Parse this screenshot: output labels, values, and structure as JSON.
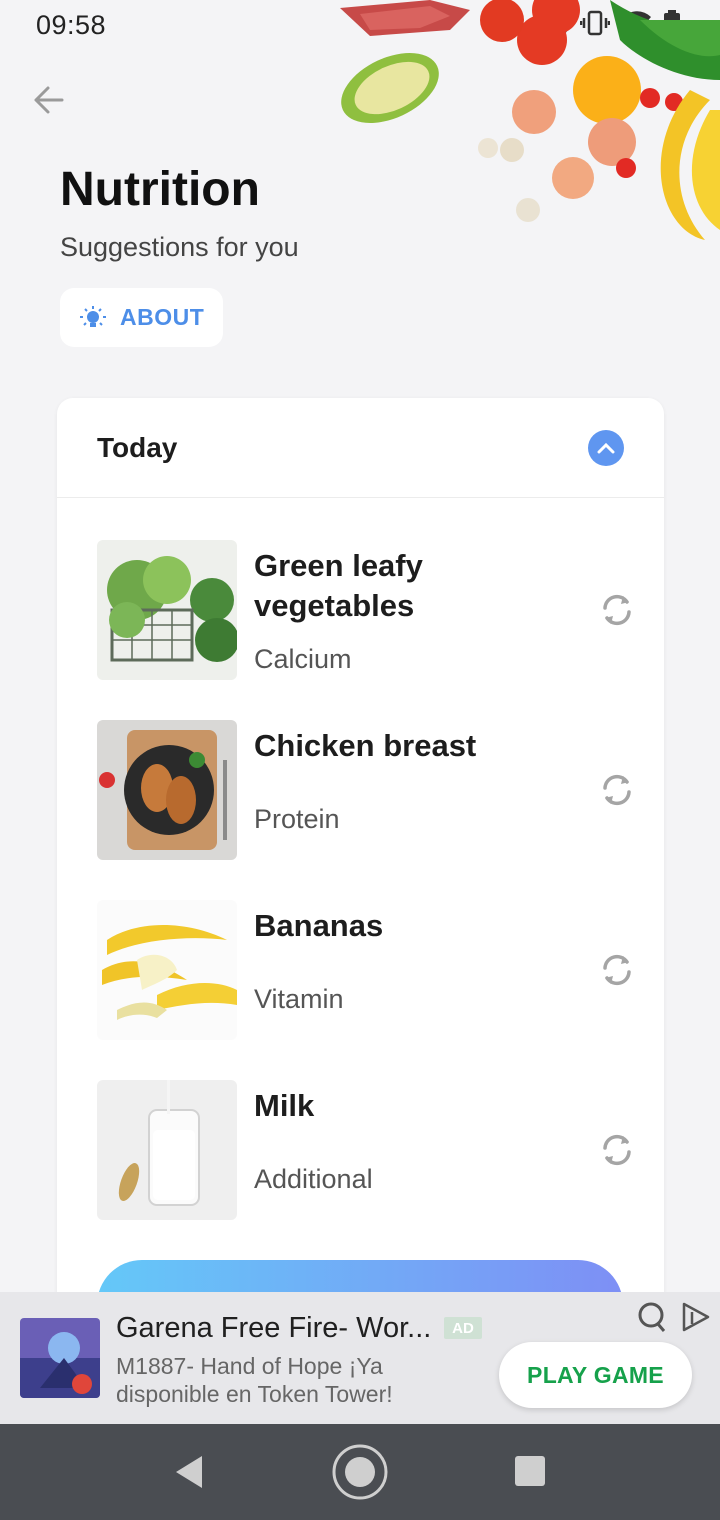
{
  "status": {
    "time": "09:58"
  },
  "header": {
    "title": "Nutrition",
    "subtitle": "Suggestions for you",
    "about_label": "ABOUT"
  },
  "card": {
    "title": "Today",
    "items": [
      {
        "name": "Green leafy vegetables",
        "category": "Calcium"
      },
      {
        "name": "Chicken breast",
        "category": "Protein"
      },
      {
        "name": "Bananas",
        "category": "Vitamin"
      },
      {
        "name": "Milk",
        "category": "Additional"
      }
    ]
  },
  "ad": {
    "title": "Garena Free Fire- Wor...",
    "badge": "AD",
    "description": "M1887- Hand of Hope ¡Ya disponible en Token Tower!",
    "cta": "PLAY GAME"
  },
  "colors": {
    "accent": "#5f96f0",
    "about_text": "#4d8ee8",
    "cta_text": "#16a14b"
  }
}
